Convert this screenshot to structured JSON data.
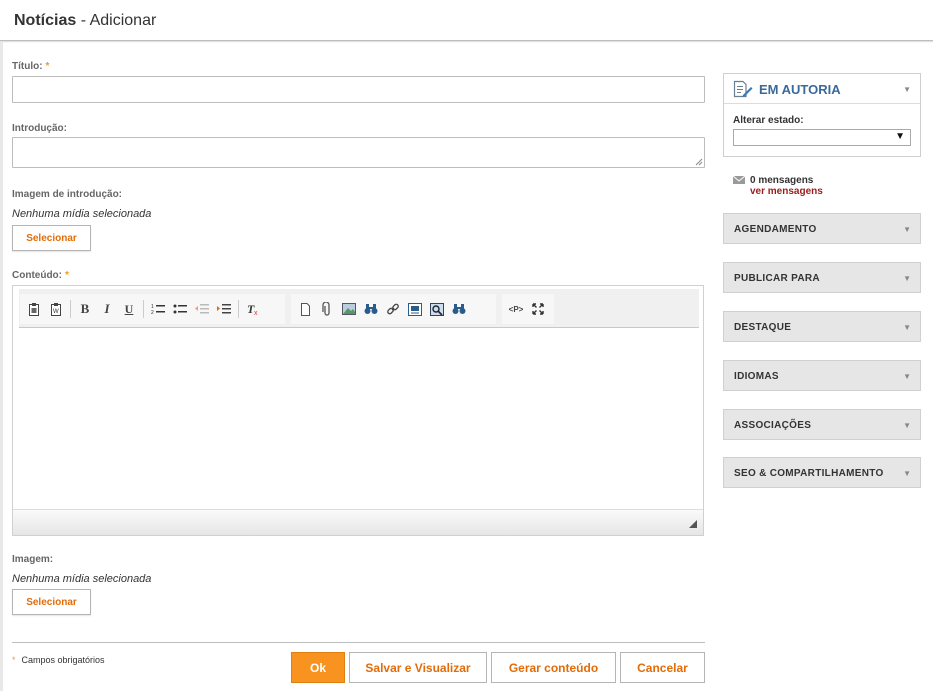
{
  "header": {
    "section": "Notícias",
    "separator": " - ",
    "action": "Adicionar"
  },
  "form": {
    "titulo_label": "Título:",
    "intro_label": "Introdução:",
    "img_intro_label": "Imagem de introdução:",
    "img_intro_note": "Nenhuma mídia selecionada",
    "select_label": "Selecionar",
    "conteudo_label": "Conteúdo:",
    "imagem_label": "Imagem:",
    "imagem_note": "Nenhuma mídia selecionada",
    "required_mark": "*"
  },
  "footer": {
    "required_note": "Campos obrigatórios",
    "ok": "Ok",
    "save_preview": "Salvar e Visualizar",
    "generate": "Gerar conteúdo",
    "cancel": "Cancelar"
  },
  "sidebar": {
    "state": "EM AUTORIA",
    "change_state_label": "Alterar estado:",
    "select_value": "",
    "messages_count": "0 mensagens",
    "messages_link": "ver mensagens",
    "sections": [
      "AGENDAMENTO",
      "PUBLICAR PARA",
      "DESTAQUE",
      "IDIOMAS",
      "ASSOCIAÇÕES",
      "SEO & COMPARTILHAMENTO"
    ]
  },
  "toolbar_icons": [
    "paste-icon",
    "paste-word-icon",
    "bold-icon",
    "italic-icon",
    "underline-icon",
    "numbered-list-icon",
    "bullet-list-icon",
    "outdent-icon",
    "indent-icon",
    "remove-format-icon",
    "document-icon",
    "attach-icon",
    "image-icon",
    "find-icon",
    "link-icon",
    "embed-icon",
    "preview-icon",
    "find-replace-icon",
    "source-code-icon",
    "maximize-icon"
  ],
  "colors": {
    "accent": "#f7931e",
    "link_orange": "#e36c09",
    "state_blue": "#3a6a9a",
    "messages_link": "#9b1c1c"
  }
}
